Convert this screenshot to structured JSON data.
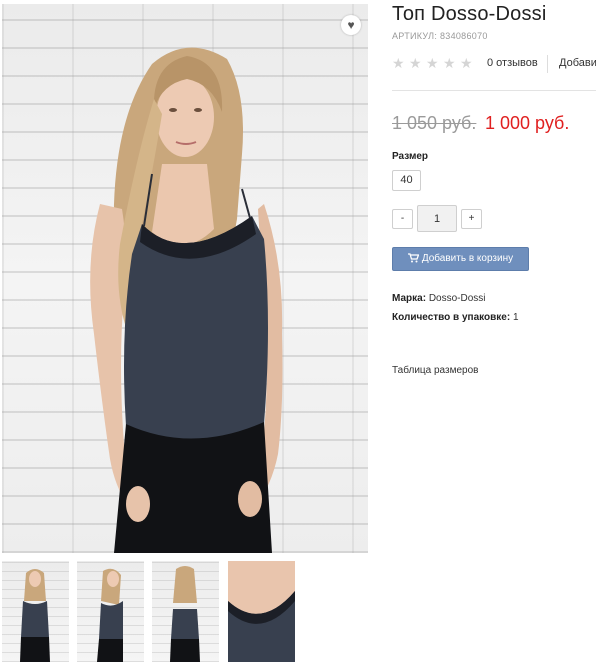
{
  "product": {
    "title": "Топ Dosso-Dossi",
    "sku_label": "АРТИКУЛ:",
    "sku_value": "834086070",
    "rating": {
      "stars": 0,
      "max_stars": 5,
      "reviews_text": "0 отзывов",
      "add_review_text": "Добави"
    },
    "price": {
      "old": "1 050 руб.",
      "current": "1 000 руб."
    },
    "size": {
      "label": "Размер",
      "options": [
        "40"
      ]
    },
    "quantity": {
      "minus": "-",
      "value": "1",
      "plus": "+"
    },
    "cart_button": "Добавить в корзину",
    "specs": {
      "brand_label": "Марка:",
      "brand_value": "Dosso-Dossi",
      "pack_label": "Количество в упаковке:",
      "pack_value": "1"
    },
    "size_table_link": "Таблица размеров"
  },
  "gallery": {
    "main_image": "woman-in-dark-camisole-photo",
    "thumbnails": [
      "front-view",
      "side-view",
      "back-view",
      "lace-detail"
    ],
    "wishlist_icon": "heart-icon"
  },
  "colors": {
    "price_current": "#e02020",
    "price_old": "#9a9a9a",
    "cart_button": "#6f8fbd",
    "star_empty": "#d5d5d5"
  }
}
